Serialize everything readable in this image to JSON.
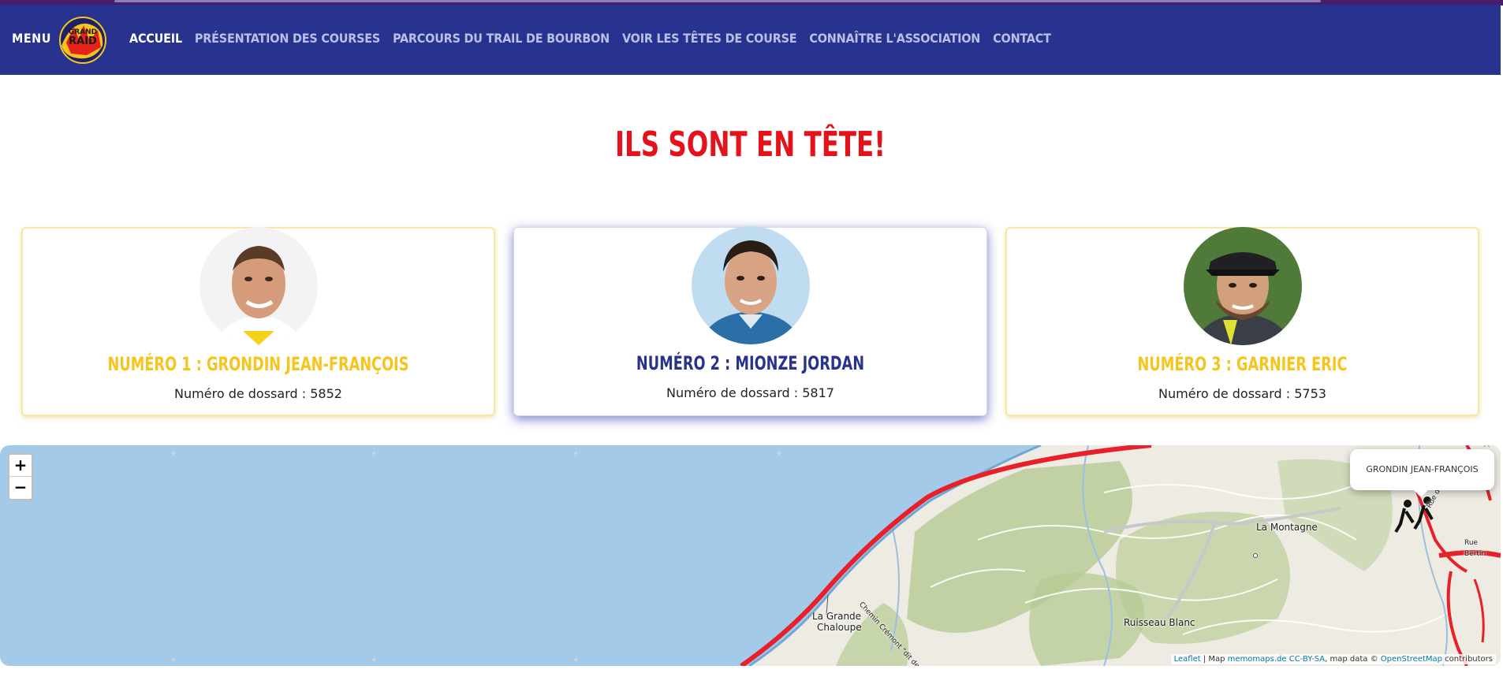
{
  "nav": {
    "menu_label": "MENU",
    "logo_alt": "Grand Raid",
    "links": [
      {
        "label": "ACCUEIL",
        "active": true
      },
      {
        "label": "PRÉSENTATION DES COURSES",
        "active": false
      },
      {
        "label": "PARCOURS DU TRAIL DE BOURBON",
        "active": false
      },
      {
        "label": "VOIR LES TÊTES DE COURSE",
        "active": false
      },
      {
        "label": "CONNAÎTRE L'ASSOCIATION",
        "active": false
      },
      {
        "label": "CONTACT",
        "active": false
      }
    ]
  },
  "heading": "ILS SONT EN TÊTE!",
  "leaders": [
    {
      "name": "NUMÉRO 1 : GRONDIN JEAN-FRANÇOIS",
      "bib": "Numéro de dossard : 5852"
    },
    {
      "name": "NUMÉRO 2 : MIONZE JORDAN",
      "bib": "Numéro de dossard : 5817"
    },
    {
      "name": "NUMÉRO 3 : GARNIER ERIC",
      "bib": "Numéro de dossard : 5753"
    }
  ],
  "map": {
    "zoom_in": "+",
    "zoom_out": "−",
    "popup_text": "GRONDIN JEAN-FRANÇOIS",
    "popup_close": "×",
    "places": {
      "la_montagne": "La Montagne",
      "grande_chaloupe_1": "La Grande",
      "grande_chaloupe_2": "Chaloupe",
      "ruisseau_blanc": "Ruisseau Blanc",
      "rue_de_la_digue": "Rue de la Digue",
      "rue_bertin": "Rue Bertin",
      "chemin_cremont": "Chemin Crémont \"dit des Anglais\""
    },
    "attribution": {
      "leaflet": "Leaflet",
      "sep1": " | Map ",
      "memomaps": "memomaps.de CC-BY-SA",
      "sep2": ", map data © ",
      "osm": "OpenStreetMap",
      "tail": " contributors"
    }
  },
  "colors": {
    "nav_bg": "#27338e",
    "heading": "#e3121b",
    "gold": "#f6c41c",
    "navy": "#27338e",
    "sea": "#a3cbe9",
    "route": "#e8202a"
  }
}
